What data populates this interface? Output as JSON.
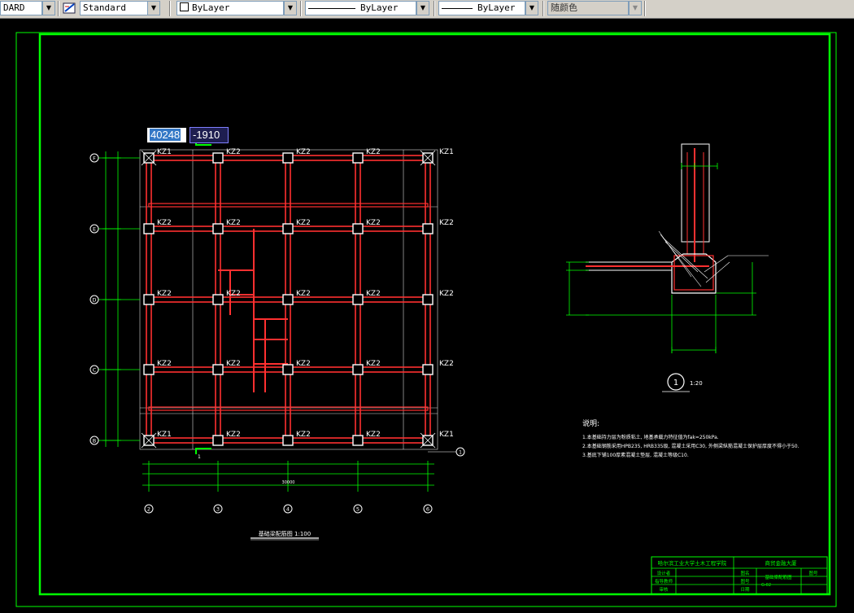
{
  "toolbar": {
    "text_style_partial": "DARD",
    "dim_style": "Standard",
    "layer_color": "ByLayer",
    "linetype": "ByLayer",
    "lineweight": "ByLayer",
    "plot_color": "随颜色"
  },
  "cursor": {
    "x": "40248",
    "y": "-1910"
  },
  "plan": {
    "grid_rows": [
      "F",
      "E",
      "D",
      "C",
      "B"
    ],
    "grid_cols": [
      "2",
      "3",
      "4",
      "5",
      "6"
    ],
    "col_kz2": "KZ2",
    "col_kz1": "KZ1",
    "section_mark": "1",
    "title": "基础梁配筋图 1:100",
    "total_span": "30000"
  },
  "detail": {
    "circle_label": "1",
    "scale": "1:20"
  },
  "notes": {
    "heading": "说明:",
    "lines": [
      "1.本基础持力层为粉质粘土, 地基承载力特征值为fak=250kPa.",
      "2.本基础钢筋采用HPB235, HRB335级, 混凝土采用C30, 外侧梁纵筋混凝土保护层厚度不得小于50.",
      "3.基底下铺100厚素混凝土垫层, 混凝土等级C10."
    ]
  },
  "title_block": {
    "school": "哈尔滨工业大学土木工程学院",
    "project": "商贸金融大厦",
    "drawing": "基础梁配筋图",
    "label_design": "设计者",
    "label_check": "指导教师",
    "label_approve": "审核",
    "label_name": "图名",
    "label_no": "图号",
    "label_date": "日期",
    "sheet_no": "G-02",
    "sheet_label": "图号"
  },
  "colors": {
    "frame": "#00ff00",
    "beam": "#ff3030",
    "annotation": "#ffffff"
  }
}
